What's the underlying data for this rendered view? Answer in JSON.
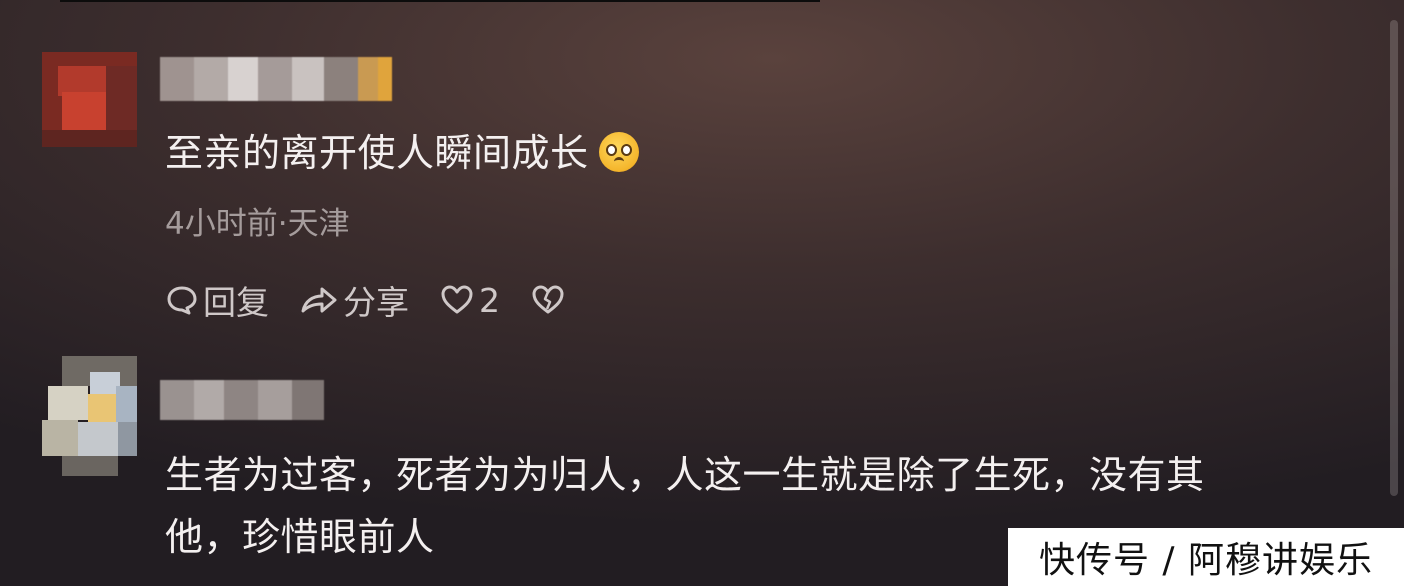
{
  "comments": [
    {
      "text": "至亲的离开使人瞬间成长",
      "emoji": "pleading-face",
      "meta": "4小时前·天津",
      "reply_label": "回复",
      "share_label": "分享",
      "like_count": "2"
    },
    {
      "text_line1": "生者为过客，死者为为归人，人这一生就是除了生死，没有其",
      "text_line2": "他，珍惜眼前人"
    }
  ],
  "icons": [
    "comment-bubble-icon",
    "share-arrow-icon",
    "heart-icon",
    "broken-heart-icon"
  ],
  "watermark": "快传号 / 阿穆讲娱乐",
  "colors": {
    "background_top": "#5a423d",
    "background_bottom": "#221d22",
    "text": "#f4f0f0",
    "meta_text": "#a59c9c",
    "action_text": "#cfc8c8"
  }
}
